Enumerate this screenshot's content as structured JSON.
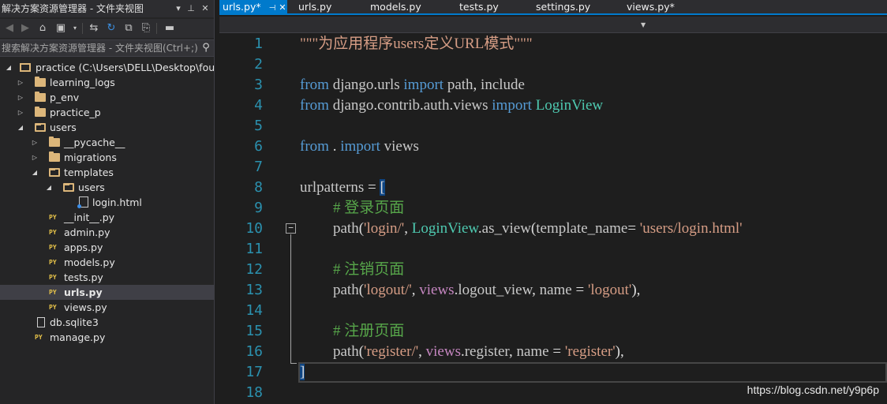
{
  "explorer": {
    "title": "解决方案资源管理器 - 文件夹视图",
    "search_placeholder": "搜索解决方案资源管理器 - 文件夹视图(Ctrl+;)",
    "tree": [
      {
        "label": "practice (C:\\Users\\DELL\\Desktop\\four\\l",
        "kind": "project"
      },
      {
        "label": "learning_logs",
        "kind": "folder"
      },
      {
        "label": "p_env",
        "kind": "folder"
      },
      {
        "label": "practice_p",
        "kind": "folder"
      },
      {
        "label": "users",
        "kind": "folder"
      },
      {
        "label": "__pycache__",
        "kind": "folder"
      },
      {
        "label": "migrations",
        "kind": "folder"
      },
      {
        "label": "templates",
        "kind": "folder"
      },
      {
        "label": "users",
        "kind": "folder"
      },
      {
        "label": "login.html",
        "kind": "html"
      },
      {
        "label": "__init__.py",
        "kind": "py"
      },
      {
        "label": "admin.py",
        "kind": "py"
      },
      {
        "label": "apps.py",
        "kind": "py"
      },
      {
        "label": "models.py",
        "kind": "py"
      },
      {
        "label": "tests.py",
        "kind": "py"
      },
      {
        "label": "urls.py",
        "kind": "py",
        "selected": true
      },
      {
        "label": "views.py",
        "kind": "py"
      },
      {
        "label": "db.sqlite3",
        "kind": "file"
      },
      {
        "label": "manage.py",
        "kind": "py"
      }
    ]
  },
  "tabs": [
    {
      "label": "urls.py*",
      "active": true
    },
    {
      "label": "urls.py"
    },
    {
      "label": "models.py"
    },
    {
      "label": "tests.py"
    },
    {
      "label": "settings.py"
    },
    {
      "label": "views.py*"
    }
  ],
  "editor": {
    "line_numbers": [
      "1",
      "2",
      "3",
      "4",
      "5",
      "6",
      "7",
      "8",
      "9",
      "10",
      "11",
      "12",
      "13",
      "14",
      "15",
      "16",
      "17",
      "18"
    ],
    "line1": "\"\"\"为应用程序users定义URL模式\"\"\"",
    "line9": "# 登录页面",
    "line10_str1": "'login/'",
    "line10_str2": "'users/login.html'",
    "line12": "# 注销页面",
    "line13_str1": "'logout/'",
    "line13_str2": "'logout'",
    "line15": "# 注册页面",
    "line16_str1": "'register/'",
    "line16_str2": "'register'"
  },
  "watermark": "https://blog.csdn.net/y9p6p"
}
